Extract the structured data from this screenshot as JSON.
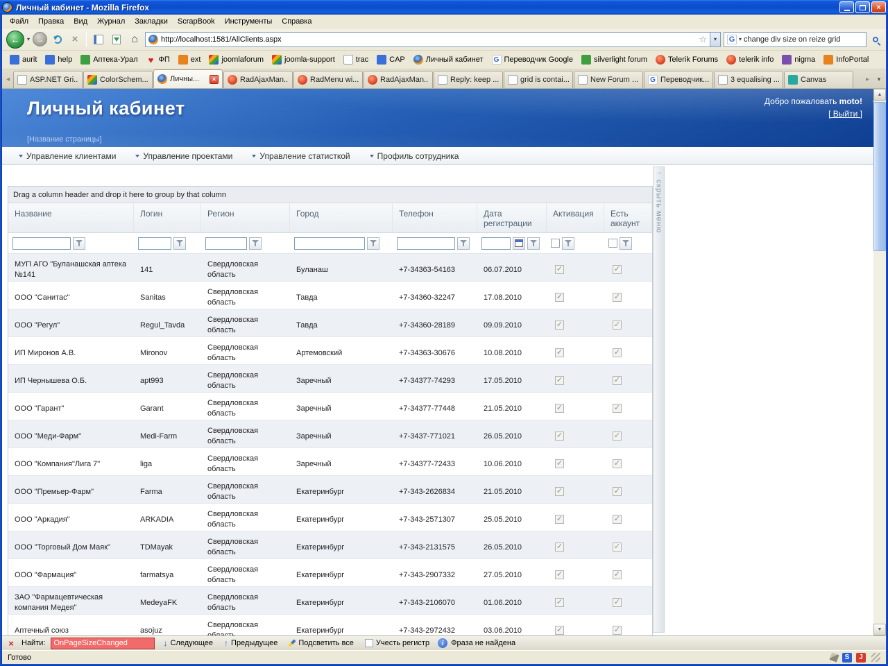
{
  "window": {
    "title": "Личный кабинет - Mozilla Firefox"
  },
  "browser_menu": {
    "items": [
      "Файл",
      "Правка",
      "Вид",
      "Журнал",
      "Закладки",
      "ScrapBook",
      "Инструменты",
      "Справка"
    ]
  },
  "navbar": {
    "url": "http://localhost:1581/AllClients.aspx",
    "search_value": "change div size on reize grid"
  },
  "bookmarks": {
    "items": [
      {
        "label": "aurit",
        "icon": "blue"
      },
      {
        "label": "help",
        "icon": "blue"
      },
      {
        "label": "Аптека-Урал",
        "icon": "green"
      },
      {
        "label": "ФП",
        "icon": "heart"
      },
      {
        "label": "ext",
        "icon": "orange"
      },
      {
        "label": "joomlaforum",
        "icon": "rainbow"
      },
      {
        "label": "joomla-support",
        "icon": "rainbow"
      },
      {
        "label": "trac",
        "icon": "document"
      },
      {
        "label": "CAP",
        "icon": "blue"
      },
      {
        "label": "Личный кабинет",
        "icon": "firefox"
      },
      {
        "label": "Переводчик Google",
        "icon": "google"
      },
      {
        "label": "silverlight forum",
        "icon": "green"
      },
      {
        "label": "Telerik Forums",
        "icon": "telerik"
      },
      {
        "label": "telerik info",
        "icon": "telerik"
      },
      {
        "label": "nigma",
        "icon": "purple"
      },
      {
        "label": "InfoPortal",
        "icon": "orange"
      }
    ]
  },
  "tabs": [
    {
      "label": "ASP.NET Gri...",
      "icon": "document",
      "active": false
    },
    {
      "label": "ColorSchem...",
      "icon": "rainbow",
      "active": false
    },
    {
      "label": "Личны...",
      "icon": "firefox",
      "active": true
    },
    {
      "label": "RadAjaxMan...",
      "icon": "telerik",
      "active": false
    },
    {
      "label": "RadMenu wi...",
      "icon": "telerik",
      "active": false
    },
    {
      "label": "RadAjaxMan...",
      "icon": "telerik",
      "active": false
    },
    {
      "label": "Reply: keep ...",
      "icon": "document",
      "active": false
    },
    {
      "label": "grid is contai...",
      "icon": "document",
      "active": false
    },
    {
      "label": "New Forum ...",
      "icon": "document",
      "active": false
    },
    {
      "label": "Переводчик...",
      "icon": "google",
      "active": false
    },
    {
      "label": "3 equalising ...",
      "icon": "document",
      "active": false
    },
    {
      "label": "Canvas",
      "icon": "teal",
      "active": false
    }
  ],
  "page": {
    "title": "Личный кабинет",
    "subtitle": "[Название страницы]",
    "welcome_prefix": "Добро пожаловать",
    "welcome_user": "moto!",
    "logout": "[ Выйти ]",
    "menu": [
      "Управление клиентами",
      "Управление проектами",
      "Управление статисткой",
      "Профиль сотрудника"
    ],
    "hide_menu_label": "скрыть меню"
  },
  "grid": {
    "group_hint": "Drag a column header and drop it here to group by that column",
    "columns": [
      "Название",
      "Логин",
      "Регион",
      "Город",
      "Телефон",
      "Дата регистрации",
      "Активация",
      "Есть аккаунт"
    ],
    "rows": [
      {
        "name": "МУП АГО \"Буланашская аптека №141",
        "login": "141",
        "region": "Свердловская область",
        "city": "Буланаш",
        "phone": "+7-34363-54163",
        "date": "06.07.2010",
        "activated": true,
        "has_account": true
      },
      {
        "name": "ООО \"Санитас\"",
        "login": "Sanitas",
        "region": "Свердловская область",
        "city": "Тавда",
        "phone": "+7-34360-32247",
        "date": "17.08.2010",
        "activated": true,
        "has_account": true
      },
      {
        "name": "ООО \"Регул\"",
        "login": "Regul_Tavda",
        "region": "Свердловская область",
        "city": "Тавда",
        "phone": "+7-34360-28189",
        "date": "09.09.2010",
        "activated": true,
        "has_account": true
      },
      {
        "name": "ИП Миронов А.В.",
        "login": "Mironov",
        "region": "Свердловская область",
        "city": "Артемовский",
        "phone": "+7-34363-30676",
        "date": "10.08.2010",
        "activated": true,
        "has_account": true
      },
      {
        "name": "ИП Чернышева О.Б.",
        "login": "apt993",
        "region": "Свердловская область",
        "city": "Заречный",
        "phone": "+7-34377-74293",
        "date": "17.05.2010",
        "activated": true,
        "has_account": true
      },
      {
        "name": "ООО \"Гарант\"",
        "login": "Garant",
        "region": "Свердловская область",
        "city": "Заречный",
        "phone": "+7-34377-77448",
        "date": "21.05.2010",
        "activated": true,
        "has_account": true
      },
      {
        "name": "ООО \"Меди-Фарм\"",
        "login": "Medi-Farm",
        "region": "Свердловская область",
        "city": "Заречный",
        "phone": "+7-3437-771021",
        "date": "26.05.2010",
        "activated": true,
        "has_account": true
      },
      {
        "name": "ООО \"Компания\"Лига 7\"",
        "login": "liga",
        "region": "Свердловская область",
        "city": "Заречный",
        "phone": "+7-34377-72433",
        "date": "10.06.2010",
        "activated": true,
        "has_account": true
      },
      {
        "name": "ООО \"Премьер-Фарм\"",
        "login": "Farma",
        "region": "Свердловская область",
        "city": "Екатеринбург",
        "phone": "+7-343-2626834",
        "date": "21.05.2010",
        "activated": true,
        "has_account": true
      },
      {
        "name": "ООО \"Аркадия\"",
        "login": "ARKADIA",
        "region": "Свердловская область",
        "city": "Екатеринбург",
        "phone": "+7-343-2571307",
        "date": "25.05.2010",
        "activated": true,
        "has_account": true
      },
      {
        "name": "ООО \"Торговый Дом Маяк\"",
        "login": "TDMayak",
        "region": "Свердловская область",
        "city": "Екатеринбург",
        "phone": "+7-343-2131575",
        "date": "26.05.2010",
        "activated": true,
        "has_account": true
      },
      {
        "name": "ООО \"Фармация\"",
        "login": "farmatsya",
        "region": "Свердловская область",
        "city": "Екатеринбург",
        "phone": "+7-343-2907332",
        "date": "27.05.2010",
        "activated": true,
        "has_account": true
      },
      {
        "name": "ЗАО \"Фармацевтическая компания Медея\"",
        "login": "MedeyaFK",
        "region": "Свердловская область",
        "city": "Екатеринбург",
        "phone": "+7-343-2106070",
        "date": "01.06.2010",
        "activated": true,
        "has_account": true
      },
      {
        "name": "Аптечный союз",
        "login": "asojuz",
        "region": "Свердловская область",
        "city": "Екатеринбург",
        "phone": "+7-343-2972432",
        "date": "03.06.2010",
        "activated": true,
        "has_account": true
      }
    ]
  },
  "findbar": {
    "label": "Найти:",
    "query": "OnPageSizeChanged",
    "next": "Следующее",
    "previous": "Предыдущее",
    "highlight_all": "Подсветить все",
    "match_case": "Учесть регистр",
    "status": "Фраза не найдена"
  },
  "statusbar": {
    "text": "Готово"
  }
}
